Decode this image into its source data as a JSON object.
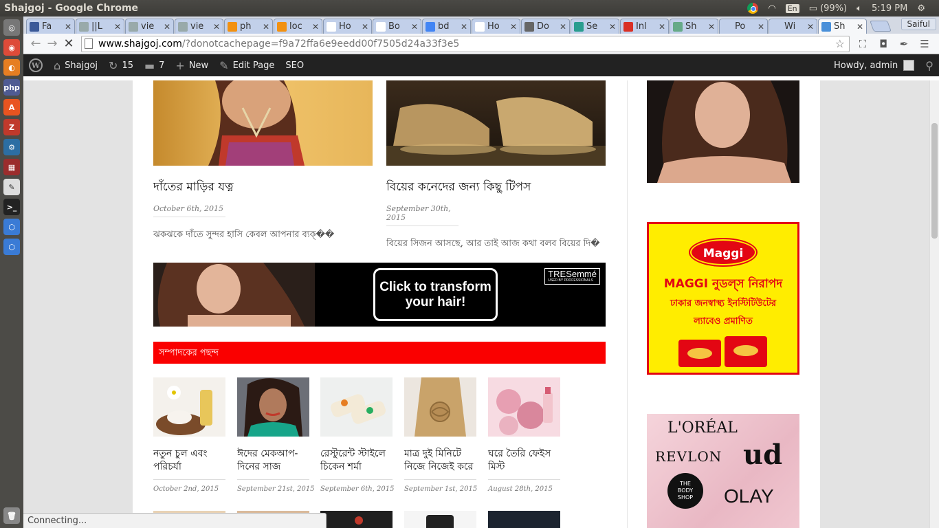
{
  "os": {
    "window_title": "Shajgoj - Google Chrome",
    "keyboard_layout": "En",
    "battery": "(99%)",
    "time": "5:19 PM"
  },
  "browser": {
    "tabs": [
      {
        "title": "Fa",
        "favicon": "facebook-icon",
        "color": "#3b5998"
      },
      {
        "title": "||L",
        "favicon": "generic-page-icon",
        "color": "#9aa"
      },
      {
        "title": "vie",
        "favicon": "generic-page-icon",
        "color": "#9aa"
      },
      {
        "title": "vie",
        "favicon": "generic-page-icon",
        "color": "#9aa"
      },
      {
        "title": "ph",
        "favicon": "phpmyadmin-icon",
        "color": "#f29111"
      },
      {
        "title": "loc",
        "favicon": "phpmyadmin-icon",
        "color": "#f29111"
      },
      {
        "title": "Ho",
        "favicon": "document-icon",
        "color": "#fff"
      },
      {
        "title": "Bo",
        "favicon": "document-icon",
        "color": "#fff"
      },
      {
        "title": "bd",
        "favicon": "google-icon",
        "color": "#4285f4"
      },
      {
        "title": "Ho",
        "favicon": "document-icon",
        "color": "#fff"
      },
      {
        "title": "Do",
        "favicon": "download-icon",
        "color": "#666"
      },
      {
        "title": "Se",
        "favicon": "seo-icon",
        "color": "#2a9d8f"
      },
      {
        "title": "Inl",
        "favicon": "gmail-icon",
        "color": "#d93025"
      },
      {
        "title": "Sh",
        "favicon": "site-icon",
        "color": "#6a8"
      },
      {
        "title": "Po",
        "favicon": "blank-icon",
        "color": "#c2d0ea"
      },
      {
        "title": "Wi",
        "favicon": "blank-icon",
        "color": "#c2d0ea"
      },
      {
        "title": "Sh",
        "favicon": "loading-icon",
        "color": "#4a90d9"
      }
    ],
    "profile_name": "Saiful",
    "url_host": "www.shajgoj.com",
    "url_path": "/?donotcachepage=f9a72ffa6e9eedd00f7505d24a33f3e5",
    "status_text": "Connecting..."
  },
  "wpadmin": {
    "site_name": "Shajgoj",
    "updates_count": "15",
    "comments_count": "7",
    "new_label": "New",
    "edit_label": "Edit Page",
    "seo_label": "SEO",
    "howdy": "Howdy, admin"
  },
  "posts": [
    {
      "title": "দাঁতের মাড়ির যত্ন",
      "date": "October 6th, 2015",
      "excerpt": "ঝকঝকে দাঁতে সুন্দর হাসি কেবল আপনার ব্যক্��"
    },
    {
      "title": "বিয়ের কনেদের জন্য কিছু টিপস",
      "date": "September 30th, 2015",
      "excerpt": "বিয়ের সিজন আসছে, আর তাই আজ কথা বলব বিয়ের দি�"
    }
  ],
  "banner": {
    "cta_line1": "Click to transform",
    "cta_line2": "your hair!",
    "brand": "TRESemmé",
    "brand_sub": "USED BY PROFESSIONALS"
  },
  "editors_pick": {
    "heading": "সম্পাদকের পছন্দ",
    "items": [
      {
        "title": "নতুন চুল এবং পরিচর্যা",
        "date": "October 2nd, 2015"
      },
      {
        "title": "ঈদের মেকআপ- দিনের সাজ",
        "date": "September 21st, 2015"
      },
      {
        "title": "রেস্টুরেন্ট স্টাইলে চিকেন শর্মা",
        "date": "September 6th, 2015"
      },
      {
        "title": "মাত্র দুই মিনিটে নিজে নিজেই করে",
        "date": "September 1st, 2015"
      },
      {
        "title": "ঘরে তৈরি ফেইস মিস্ট",
        "date": "August 28th, 2015"
      }
    ]
  },
  "sidebar": {
    "maggi_logo": "Maggi",
    "maggi_headline": "MAGGI নুডল্স নিরাপদ",
    "maggi_line1": "ঢাকার জনস্বাস্থ্য ইনস্টিটিউটের",
    "maggi_line2": "ল্যাবেও প্রমাণিত",
    "brands": [
      "L'ORÉAL",
      "REVLON",
      "ud",
      "THE BODY SHOP",
      "OLAY"
    ]
  },
  "colors": {
    "section_red": "#fa0000",
    "maggi_yellow": "#ffed00",
    "maggi_red": "#e30613",
    "wp_bar": "#222222"
  }
}
